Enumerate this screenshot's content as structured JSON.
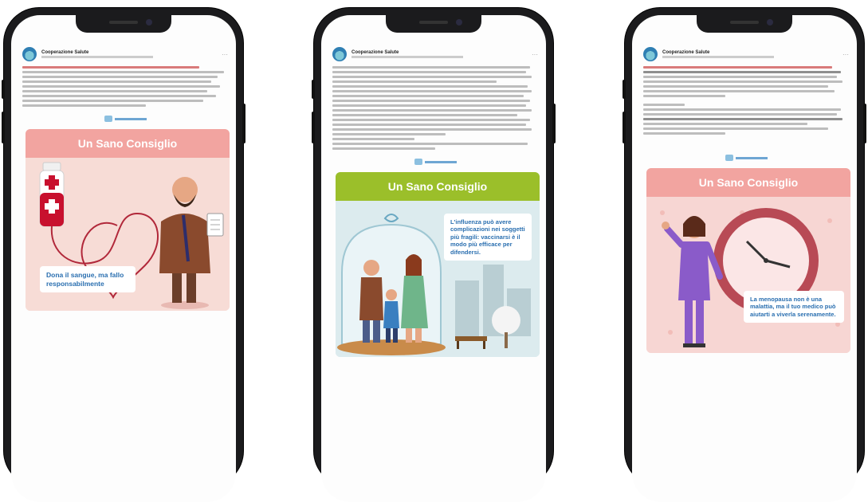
{
  "phones": [
    {
      "page_name": "Cooperazione Salute",
      "card_title": "Un Sano Consiglio",
      "caption": "Dona il sangue, ma fallo responsabilmente",
      "colors": {
        "header": "#f2a4a0",
        "card_bg": "#f7dcd6",
        "caption_text": "#2a6fb0"
      }
    },
    {
      "page_name": "Cooperazione Salute",
      "card_title": "Un Sano Consiglio",
      "caption": "L'influenza può avere complicazioni nei soggetti più fragili: vaccinarsi è il modo più efficace per difendersi.",
      "colors": {
        "header": "#9bbf2a",
        "card_bg": "#cfe3e8",
        "caption_text": "#2a6fb0"
      }
    },
    {
      "page_name": "Cooperazione Salute",
      "card_title": "Un Sano Consiglio",
      "caption": "La menopausa non è una malattia, ma il tuo medico può aiutarti a viverla serenamente.",
      "colors": {
        "header": "#f2a4a0",
        "card_bg": "#f7d6d3",
        "caption_text": "#2a6fb0"
      }
    }
  ]
}
